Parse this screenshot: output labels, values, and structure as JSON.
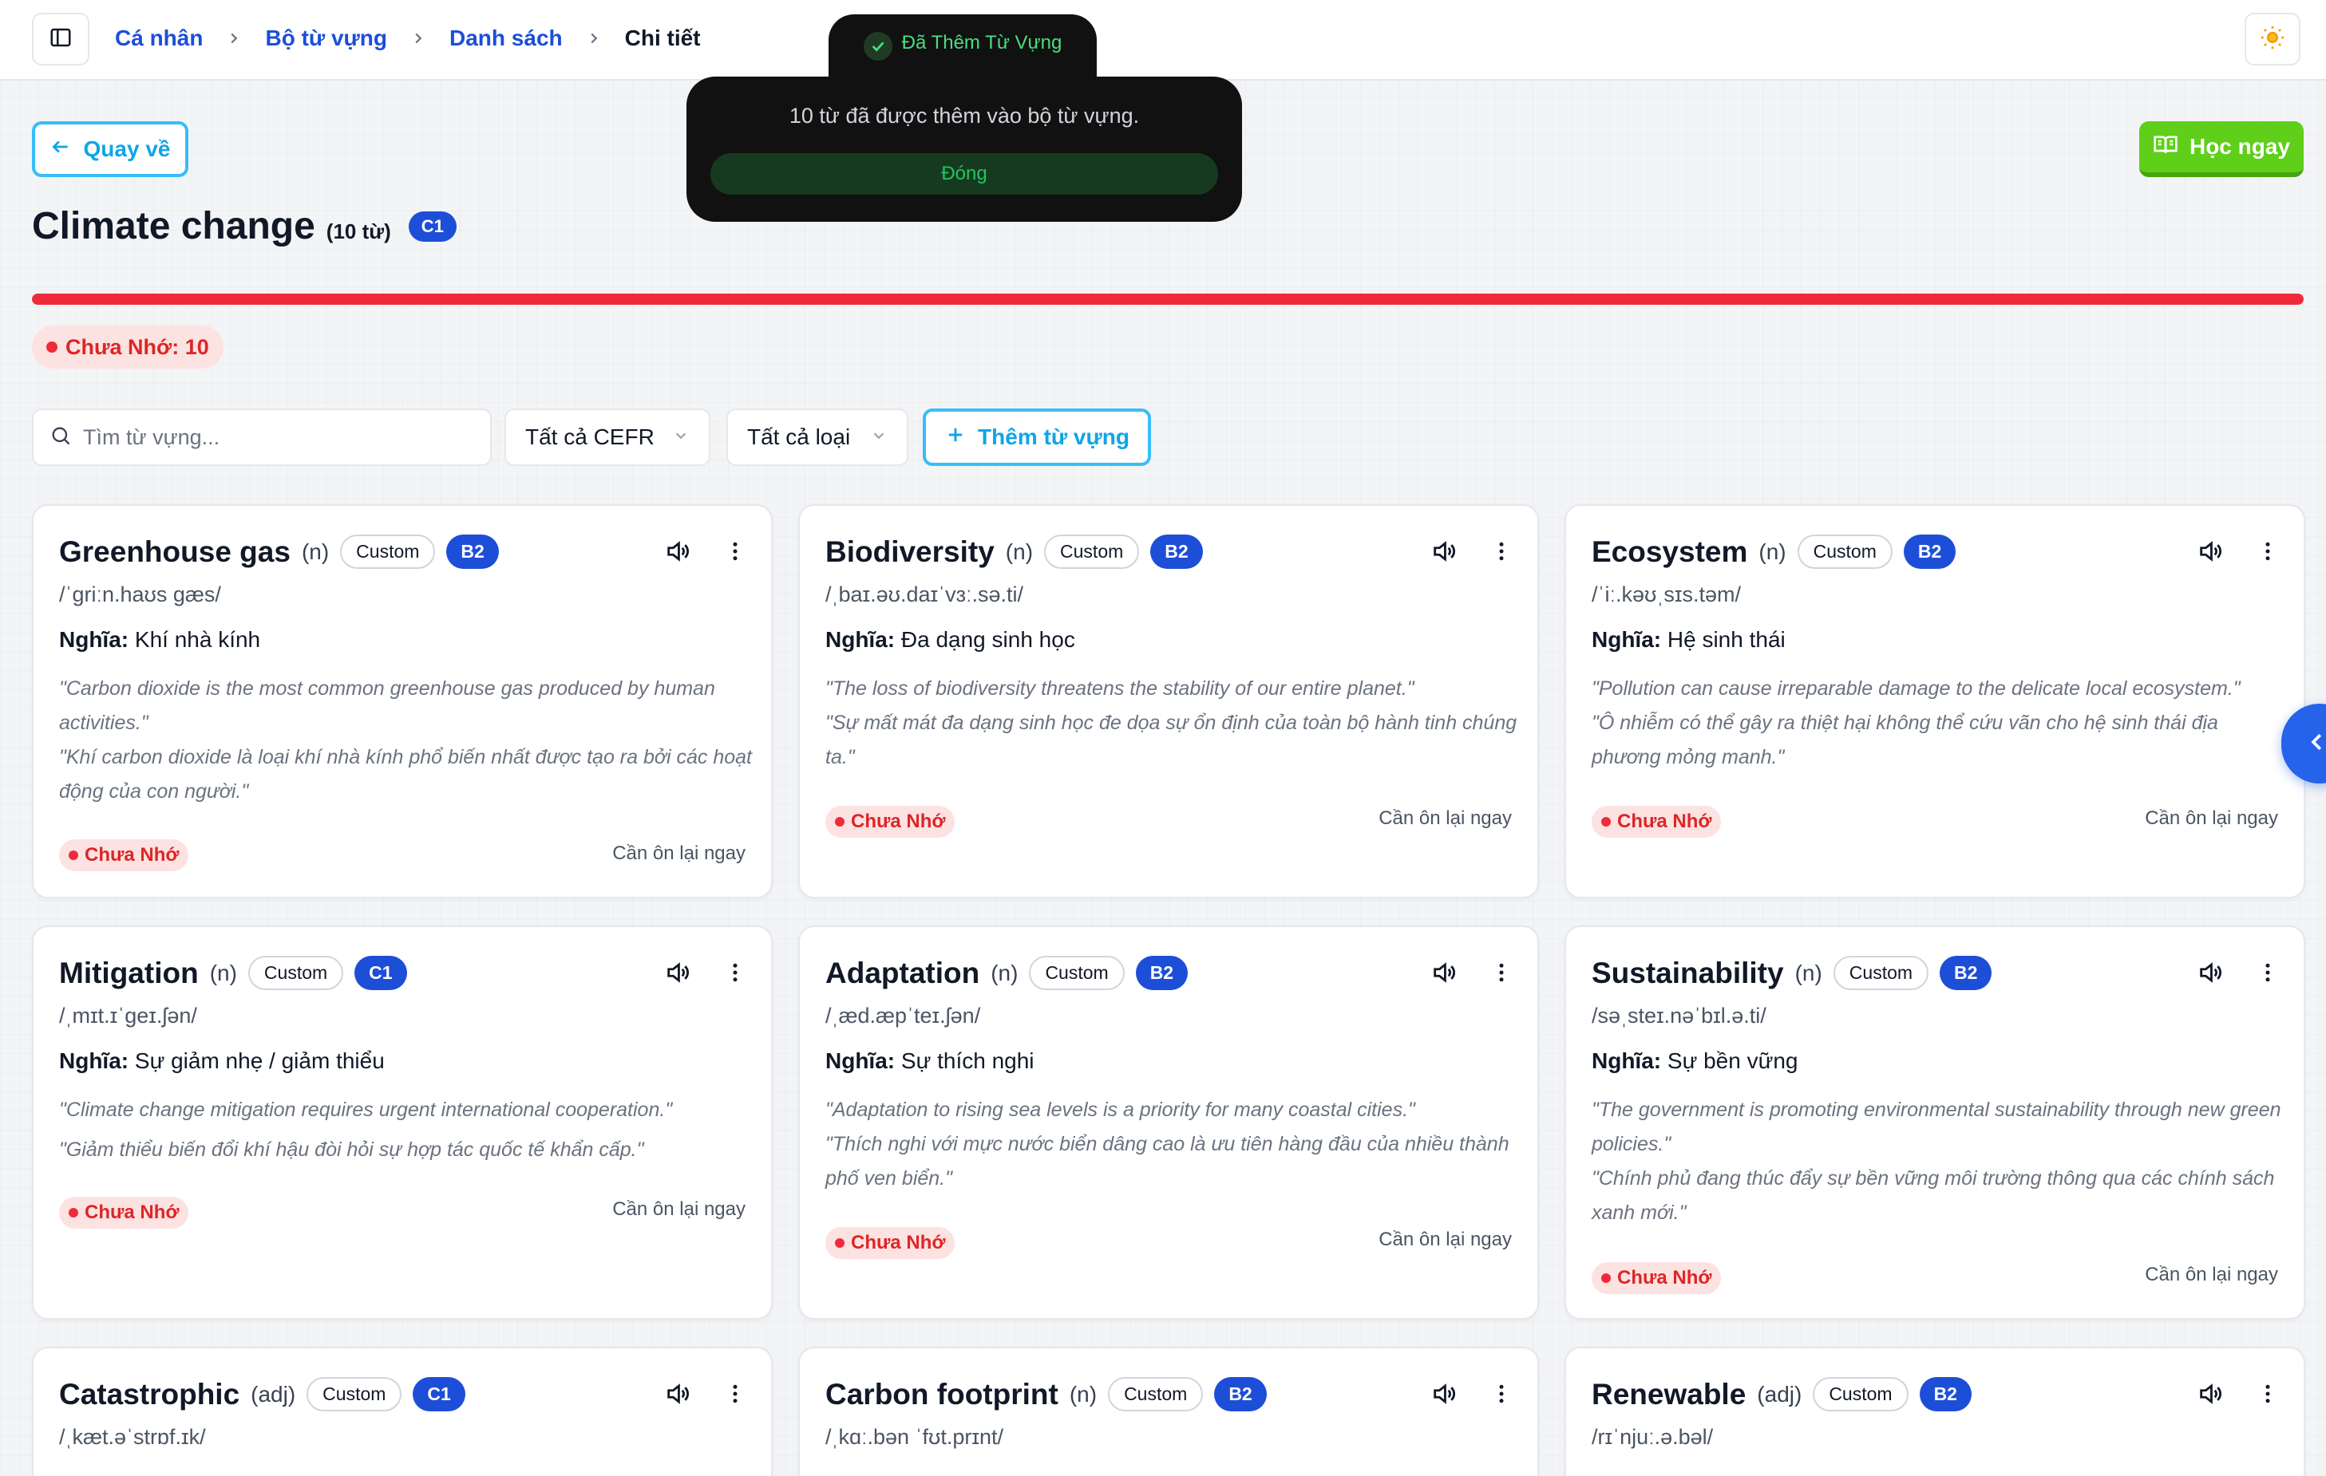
{
  "breadcrumb": {
    "items": [
      "Cá nhân",
      "Bộ từ vựng",
      "Danh sách"
    ],
    "current": "Chi tiết"
  },
  "toast": {
    "title": "Đã Thêm Từ Vựng",
    "message": "10 từ đã được thêm vào bộ từ vựng.",
    "close_label": "Đóng"
  },
  "actions": {
    "back_label": "Quay về",
    "learn_label": "Học ngay"
  },
  "set": {
    "name": "Climate change",
    "count": "(10 từ)",
    "level": "C1",
    "progress_unlearned": 1.0
  },
  "stats": {
    "unlearned": "Chưa Nhớ: 10"
  },
  "filters": {
    "search_placeholder": "Tìm từ vựng...",
    "cefr": "Tất cả CEFR",
    "type": "Tất cả loại",
    "add_label": "Thêm từ vựng"
  },
  "colors": {
    "accent": "#0ea5e9",
    "learn": "#5fcf1a",
    "level": "#1d4ed8",
    "danger": "#ef2b3b"
  },
  "cards": [
    {
      "word": "Greenhouse gas",
      "pos": "(n)",
      "tag": "Custom",
      "level": "B2",
      "ipa": "/ˈɡriːn.haʊs ɡæs/",
      "meaning_label": "Nghĩa:",
      "meaning": "Khí nhà kính",
      "example_en": "\"Carbon dioxide is the most common greenhouse gas produced by human activities.\"",
      "example_vi": "\"Khí carbon dioxide là loại khí nhà kính phổ biến nhất được tạo ra bởi các hoạt động của con người.\"",
      "status": "Chưa Nhớ",
      "review": "Cần ôn lại ngay"
    },
    {
      "word": "Biodiversity",
      "pos": "(n)",
      "tag": "Custom",
      "level": "B2",
      "ipa": "/ˌbaɪ.əʊ.daɪˈvɜː.sə.ti/",
      "meaning_label": "Nghĩa:",
      "meaning": "Đa dạng sinh học",
      "example_en": "\"The loss of biodiversity threatens the stability of our entire planet.\"",
      "example_vi": "\"Sự mất mát đa dạng sinh học đe dọa sự ổn định của toàn bộ hành tinh chúng ta.\"",
      "status": "Chưa Nhớ",
      "review": "Cần ôn lại ngay"
    },
    {
      "word": "Ecosystem",
      "pos": "(n)",
      "tag": "Custom",
      "level": "B2",
      "ipa": "/ˈiː.kəʊˌsɪs.təm/",
      "meaning_label": "Nghĩa:",
      "meaning": "Hệ sinh thái",
      "example_en": "\"Pollution can cause irreparable damage to the delicate local ecosystem.\"",
      "example_vi": "\"Ô nhiễm có thể gây ra thiệt hại không thể cứu vãn cho hệ sinh thái địa phương mỏng manh.\"",
      "status": "Chưa Nhớ",
      "review": "Cần ôn lại ngay"
    },
    {
      "word": "Mitigation",
      "pos": "(n)",
      "tag": "Custom",
      "level": "C1",
      "ipa": "/ˌmɪt.ɪˈɡeɪ.ʃən/",
      "meaning_label": "Nghĩa:",
      "meaning": "Sự giảm nhẹ / giảm thiểu",
      "example_en": "\"Climate change mitigation requires urgent international cooperation.\"",
      "example_vi": "\"Giảm thiểu biến đổi khí hậu đòi hỏi sự hợp tác quốc tế khẩn cấp.\"",
      "status": "Chưa Nhớ",
      "review": "Cần ôn lại ngay"
    },
    {
      "word": "Adaptation",
      "pos": "(n)",
      "tag": "Custom",
      "level": "B2",
      "ipa": "/ˌæd.æpˈteɪ.ʃən/",
      "meaning_label": "Nghĩa:",
      "meaning": "Sự thích nghi",
      "example_en": "\"Adaptation to rising sea levels is a priority for many coastal cities.\"",
      "example_vi": "\"Thích nghi với mực nước biển dâng cao là ưu tiên hàng đầu của nhiều thành phố ven biển.\"",
      "status": "Chưa Nhớ",
      "review": "Cần ôn lại ngay"
    },
    {
      "word": "Sustainability",
      "pos": "(n)",
      "tag": "Custom",
      "level": "B2",
      "ipa": "/səˌsteɪ.nəˈbɪl.ə.ti/",
      "meaning_label": "Nghĩa:",
      "meaning": "Sự bền vững",
      "example_en": "\"The government is promoting environmental sustainability through new green policies.\"",
      "example_vi": "\"Chính phủ đang thúc đẩy sự bền vững môi trường thông qua các chính sách xanh mới.\"",
      "status": "Chưa Nhớ",
      "review": "Cần ôn lại ngay"
    },
    {
      "word": "Catastrophic",
      "pos": "(adj)",
      "tag": "Custom",
      "level": "C1",
      "ipa": "/ˌkæt.əˈstrɒf.ɪk/"
    },
    {
      "word": "Carbon footprint",
      "pos": "(n)",
      "tag": "Custom",
      "level": "B2",
      "ipa": "/ˌkɑː.bən ˈfʊt.prɪnt/"
    },
    {
      "word": "Renewable",
      "pos": "(adj)",
      "tag": "Custom",
      "level": "B2",
      "ipa": "/rɪˈnjuː.ə.bəl/"
    }
  ]
}
